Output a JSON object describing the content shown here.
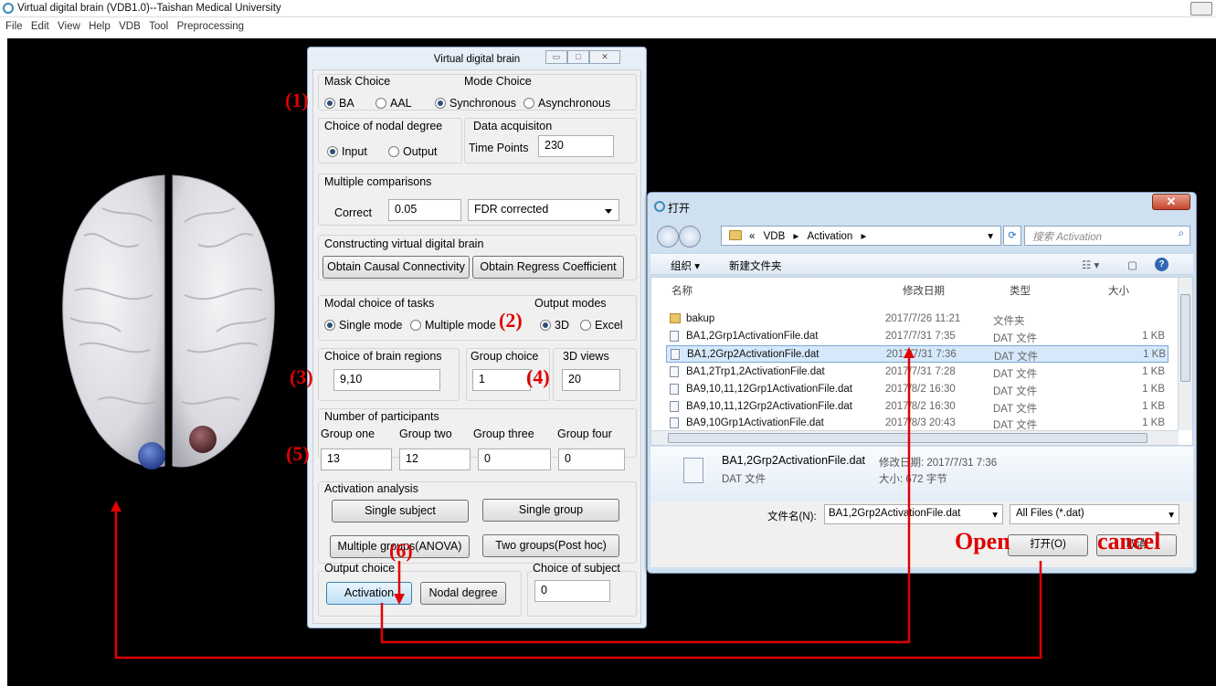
{
  "app": {
    "title": "Virtual digital brain (VDB1.0)--Taishan Medical University",
    "menu": [
      "File",
      "Edit",
      "View",
      "Help",
      "VDB",
      "Tool",
      "Preprocessing"
    ]
  },
  "vdb": {
    "title": "Virtual   digital   brain",
    "mask_choice": {
      "label": "Mask Choice",
      "options": [
        "BA",
        "AAL"
      ],
      "selected": "BA"
    },
    "mode_choice": {
      "label": "Mode Choice",
      "options": [
        "Synchronous",
        "Asynchronous"
      ],
      "selected": "Synchronous"
    },
    "nodal_degree": {
      "label": "Choice of nodal degree",
      "options": [
        "Input",
        "Output"
      ],
      "selected": "Input"
    },
    "data_acq": {
      "label": "Data acquisiton",
      "time_points_label": "Time Points",
      "time_points": "230"
    },
    "multiple_comparisons": {
      "label": "Multiple comparisons",
      "correct_label": "Correct",
      "correct": "0.05",
      "method": "FDR corrected"
    },
    "constructing": {
      "label": "Constructing virtual digital brain",
      "btn_causal": "Obtain  Causal Connectivity",
      "btn_regress": "Obtain Regress Coefficient"
    },
    "modal_choice": {
      "label": "Modal choice of tasks",
      "options": [
        "Single mode",
        "Multiple mode"
      ],
      "selected": "Single mode"
    },
    "output_modes": {
      "label": "Output modes",
      "options": [
        "3D",
        "Excel"
      ],
      "selected": "3D"
    },
    "brain_regions": {
      "label": "Choice of brain regions",
      "value": "9,10"
    },
    "group_choice": {
      "label": "Group choice",
      "value": "1"
    },
    "views_3d": {
      "label": "3D views",
      "value": "20"
    },
    "participants": {
      "label": "Number of participants",
      "groups": [
        {
          "label": "Group one",
          "value": "13"
        },
        {
          "label": "Group two",
          "value": "12"
        },
        {
          "label": "Group three",
          "value": "0"
        },
        {
          "label": "Group four",
          "value": "0"
        }
      ]
    },
    "activation_analysis": {
      "label": "Activation analysis",
      "btn_single_subject": "Single subject",
      "btn_single_group": "Single group",
      "btn_multi_groups": "Multiple groups(ANOVA)",
      "btn_two_groups": "Two groups(Post hoc)"
    },
    "output_choice": {
      "label": "Output choice",
      "btn_activation": "Activation",
      "btn_nodal": "Nodal degree"
    },
    "subject_choice": {
      "label": "Choice of subject",
      "value": "0"
    }
  },
  "open_dialog": {
    "title": "打开",
    "address": [
      "«",
      "VDB",
      "▸",
      "Activation",
      "▸"
    ],
    "search_placeholder": "搜索 Activation",
    "toolbar": {
      "organize": "组织 ▾",
      "new_folder": "新建文件夹"
    },
    "columns": [
      "名称",
      "修改日期",
      "类型",
      "大小"
    ],
    "rows": [
      {
        "name": "bakup",
        "date": "2017/7/26 11:21",
        "type": "文件夹",
        "size": "",
        "folder": true
      },
      {
        "name": "BA1,2Grp1ActivationFile.dat",
        "date": "2017/7/31 7:35",
        "type": "DAT 文件",
        "size": "1 KB"
      },
      {
        "name": "BA1,2Grp2ActivationFile.dat",
        "date": "2017/7/31 7:36",
        "type": "DAT 文件",
        "size": "1 KB",
        "selected": true
      },
      {
        "name": "BA1,2Trp1,2ActivationFile.dat",
        "date": "2017/7/31 7:28",
        "type": "DAT 文件",
        "size": "1 KB"
      },
      {
        "name": "BA9,10,11,12Grp1ActivationFile.dat",
        "date": "2017/8/2 16:30",
        "type": "DAT 文件",
        "size": "1 KB"
      },
      {
        "name": "BA9,10,11,12Grp2ActivationFile.dat",
        "date": "2017/8/2 16:30",
        "type": "DAT 文件",
        "size": "1 KB"
      },
      {
        "name": "BA9,10Grp1ActivationFile.dat",
        "date": "2017/8/3 20:43",
        "type": "DAT 文件",
        "size": "1 KB"
      }
    ],
    "details": {
      "filename": "BA1,2Grp2ActivationFile.dat",
      "modified": "修改日期: 2017/7/31 7:36",
      "type": "DAT 文件",
      "size": "大小: 672 字节"
    },
    "filename_label": "文件名(N):",
    "filename_value": "BA1,2Grp2ActivationFile.dat",
    "filter": "All Files (*.dat)",
    "btn_open": "打开(O)",
    "btn_cancel": "取消"
  },
  "annotations": {
    "n1": "(1)",
    "n2": "(2)",
    "n3": "(3)",
    "n4": "(4)",
    "n5": "(5)",
    "n6": "(6)",
    "open": "Open",
    "cancel": "cancel"
  },
  "colors": {
    "annotation": "#e00000",
    "canvas": "#000000",
    "selection": "#d6e8fb"
  }
}
